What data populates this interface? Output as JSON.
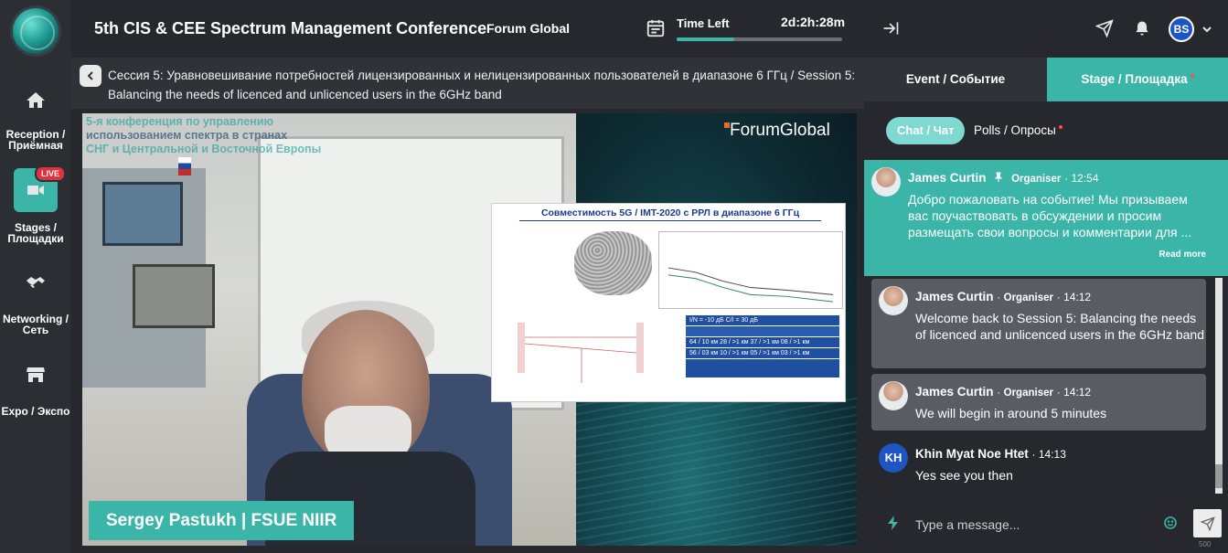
{
  "header": {
    "conference_title": "5th CIS & CEE Spectrum Management Conference",
    "organizer": "Forum Global",
    "time_left_label": "Time Left",
    "time_left_value": "2d:2h:28m",
    "time_left_progress": 0.35
  },
  "nav": {
    "items": [
      {
        "label": "Reception / Приёмная",
        "icon": "home-icon"
      },
      {
        "label": "Stages / Площадки",
        "icon": "video-camera-icon",
        "badge": "LIVE",
        "active": true
      },
      {
        "label": "Networking / Сеть",
        "icon": "handshake-icon"
      },
      {
        "label": "Expo / Экспо",
        "icon": "store-icon"
      }
    ]
  },
  "session": {
    "title": "Сессия 5: Уравновешивание потребностей лицензированных и нелицензированных пользователей в диапазоне 6 ГГц / Session 5: Balancing the needs of licenced and unlicenced users in the 6GHz band"
  },
  "video": {
    "overlay_line1": "5-я конференция по управлению",
    "overlay_line2": "использованием спектра в странах",
    "overlay_line3": "СНГ и Центральной и Восточной Европы",
    "brand_logo": "ForumGlobal",
    "slide_title": "Совместимость 5G / IMT-2020 с РРЛ в диапазоне 6 ГГц",
    "slide_table_rows": [
      "I/N = -10 дБ     C/I = 30 дБ",
      "64 / 10 км   28 / >1 км   37 / >1 км   08 / >1 км",
      "56 / 03 км   10 / >1 км   05 / >1 км   03 / >1 км"
    ],
    "speaker_label": "Sergey Pastukh | FSUE NIIR"
  },
  "panel": {
    "tabs": {
      "event": "Event / Событие",
      "stage": "Stage / Площадка"
    },
    "subtabs": {
      "chat": "Chat / Чат",
      "polls": "Polls / Опросы"
    },
    "avatar_initials": "BS",
    "messages": [
      {
        "author": "James Curtin",
        "role": "Organiser",
        "time": "12:54",
        "pinned": true,
        "body": "Добро пожаловать на событие! Мы призываем вас поучаствовать в обсуждении и просим размещать свои вопросы и комментарии для ...",
        "read_more": "Read more"
      },
      {
        "author": "James Curtin",
        "role": "Organiser",
        "time": "14:12",
        "body": "Welcome back to Session 5: Balancing the needs of licenced and unlicenced users in the 6GHz band"
      },
      {
        "author": "James Curtin",
        "role": "Organiser",
        "time": "14:12",
        "body": "We will begin in around 5 minutes"
      },
      {
        "author": "Khin Myat Noe Htet",
        "initials": "KH",
        "time": "14:13",
        "body": "Yes see you then"
      }
    ],
    "input_placeholder": "Type a message...",
    "char_counter": "500"
  },
  "colors": {
    "accent": "#3bb5a8",
    "background": "#26282d",
    "live": "#e0323c",
    "avatar": "#1d55c4"
  }
}
